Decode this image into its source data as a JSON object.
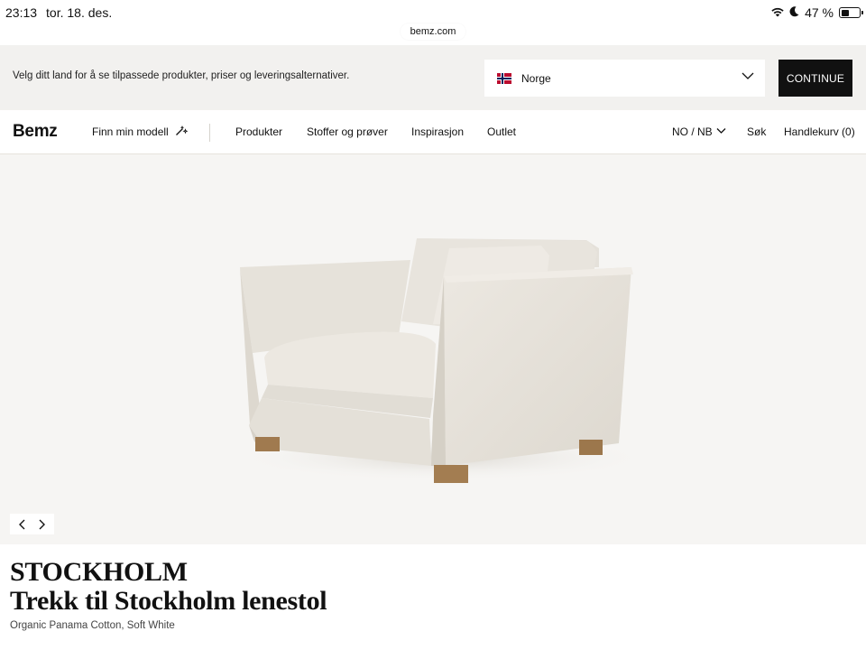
{
  "status_bar": {
    "time": "23:13",
    "date": "tor. 18. des.",
    "battery_text": "47 %",
    "battery_level": 0.47
  },
  "browser": {
    "url": "bemz.com"
  },
  "country_banner": {
    "message": "Velg ditt land for å se tilpassede produkter, priser og leveringsalternativer.",
    "selected_country": "Norge",
    "continue_label": "CONTINUE"
  },
  "header": {
    "logo": "Bemz",
    "find_model_label": "Finn min modell",
    "nav_items": [
      "Produkter",
      "Stoffer og prøver",
      "Inspirasjon",
      "Outlet"
    ],
    "language": "NO / NB",
    "search_label": "Søk",
    "cart_label": "Handlekurv (0)"
  },
  "product": {
    "model": "STOCKHOLM",
    "name": "Trekk til Stockholm lenestol",
    "variant": "Organic Panama Cotton, Soft White"
  },
  "colors": {
    "banner_bg": "#f2f1ef",
    "hero_bg": "#f6f5f3",
    "button_bg": "#111111",
    "fabric": "#e9e5de",
    "wood": "#a07a4f"
  }
}
